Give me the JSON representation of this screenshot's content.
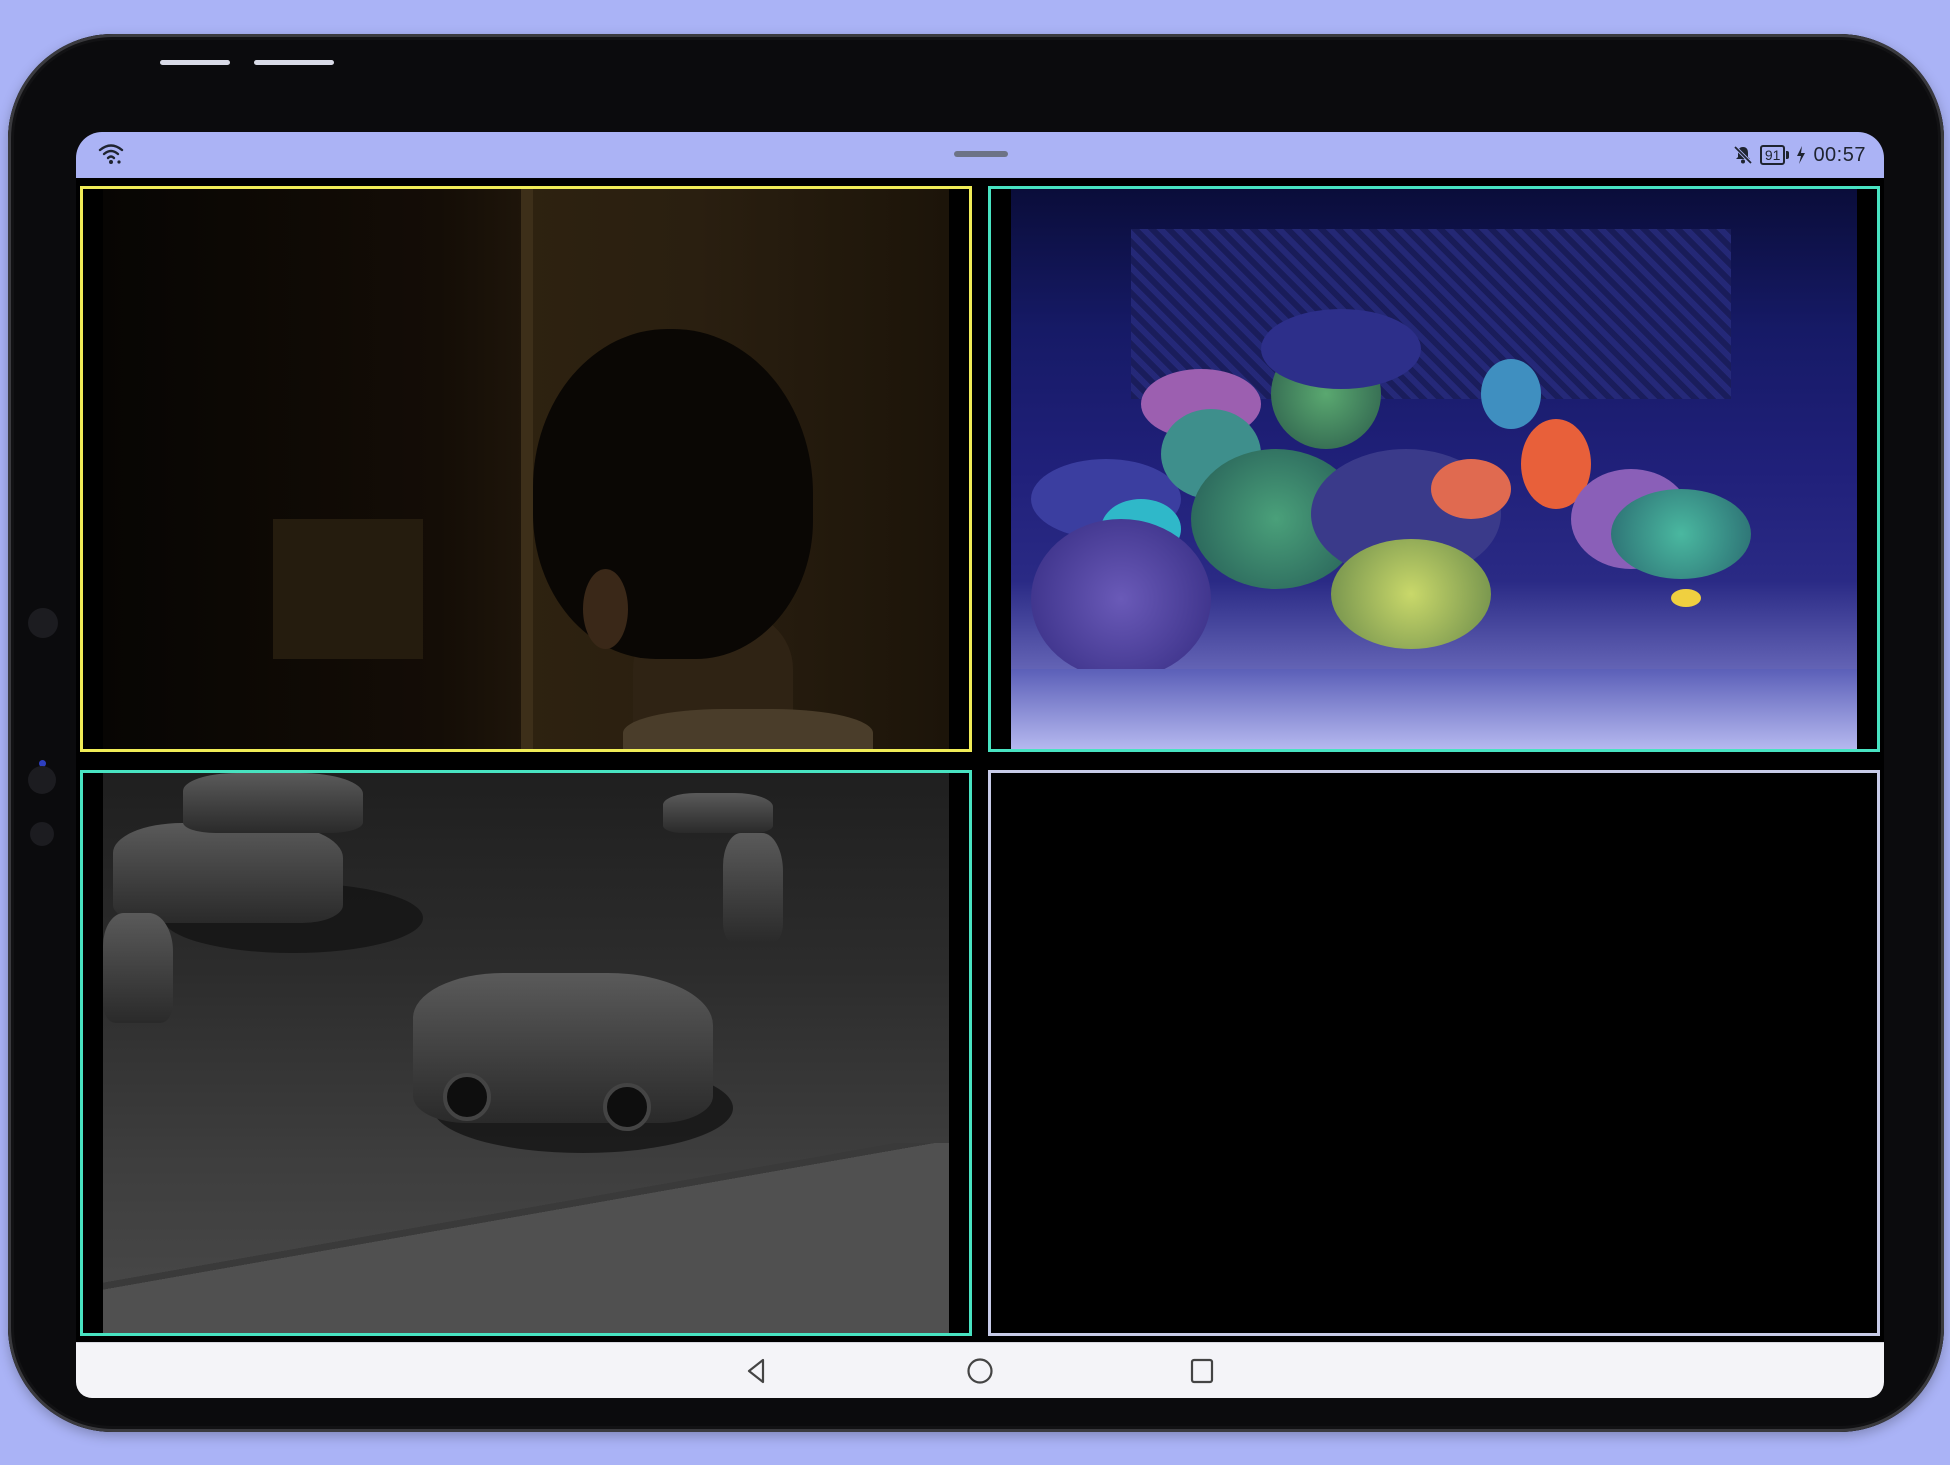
{
  "status_bar": {
    "battery_level": "91",
    "time": "00:57",
    "icons": [
      "wifi-icon",
      "notifications-off-icon",
      "battery-icon",
      "charging-icon"
    ]
  },
  "camera_grid": {
    "layout": "2x2",
    "tiles": [
      {
        "content": "indoor-feed",
        "border_color": "#f0ec57",
        "selected": true
      },
      {
        "content": "aquarium-feed",
        "border_color": "#48e3c1",
        "selected": false
      },
      {
        "content": "parking-lot-feed",
        "border_color": "#48e3c1",
        "selected": false
      },
      {
        "content": "empty",
        "border_color": "#c7cbe8",
        "selected": false
      }
    ]
  },
  "navigation_bar": {
    "icons": [
      "back-icon",
      "home-icon",
      "recents-icon"
    ]
  },
  "colors": {
    "background": "#aab3f6",
    "status_bar": "#abb3f5",
    "selected_border": "#f0ec57",
    "active_border": "#48e3c1",
    "empty_border": "#c7cbe8"
  }
}
